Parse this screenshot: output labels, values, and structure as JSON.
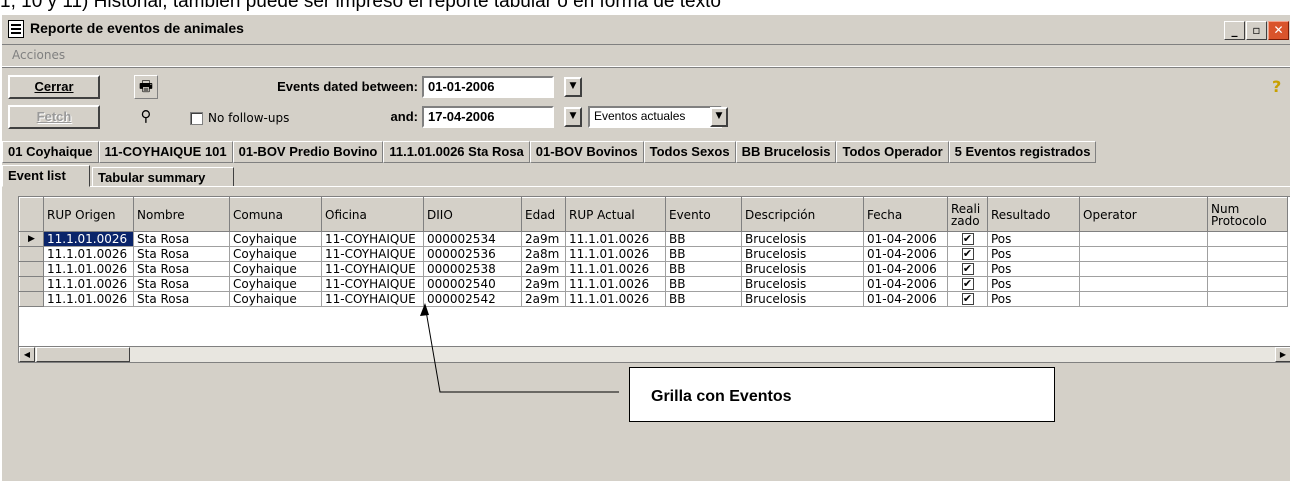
{
  "caption_text": "1, 10 y 11) Historial, tambien puede ser impreso el reporte tabular o en forma de texto",
  "window": {
    "title": "Reporte de eventos de animales",
    "minimize": "_",
    "restore": "▫",
    "close": "✕"
  },
  "menu": {
    "acciones": "Acciones"
  },
  "toolbar": {
    "cerrar": "Cerrar",
    "fetch": "Fetch",
    "events_between_label": "Events dated between:",
    "date_from": "01-01-2006",
    "and_label": "and:",
    "date_to": "17-04-2006",
    "no_followups_label": "No follow-ups",
    "eventos_select": "Eventos actuales"
  },
  "filters": [
    "01 Coyhaique",
    "11-COYHAIQUE 101",
    "01-BOV Predio Bovino",
    "11.1.01.0026 Sta Rosa",
    "01-BOV Bovinos",
    "Todos Sexos",
    "BB Brucelosis",
    "Todos Operador",
    "5 Eventos registrados"
  ],
  "tabs": [
    "Event list",
    "Tabular summary"
  ],
  "grid": {
    "headers": [
      "RUP Origen",
      "Nombre",
      "Comuna",
      "Oficina",
      "DIIO",
      "Edad",
      "RUP Actual",
      "Evento",
      "Descripción",
      "Fecha",
      "Reali zado",
      "Resultado",
      "Operator",
      "Num Protocolo"
    ],
    "rows": [
      [
        "11.1.01.0026",
        "Sta Rosa",
        "Coyhaique",
        "11-COYHAIQUE",
        "000002534",
        "2a9m",
        "11.1.01.0026",
        "BB",
        "Brucelosis",
        "01-04-2006",
        "✔",
        "Pos",
        "",
        ""
      ],
      [
        "11.1.01.0026",
        "Sta Rosa",
        "Coyhaique",
        "11-COYHAIQUE",
        "000002536",
        "2a8m",
        "11.1.01.0026",
        "BB",
        "Brucelosis",
        "01-04-2006",
        "✔",
        "Pos",
        "",
        ""
      ],
      [
        "11.1.01.0026",
        "Sta Rosa",
        "Coyhaique",
        "11-COYHAIQUE",
        "000002538",
        "2a9m",
        "11.1.01.0026",
        "BB",
        "Brucelosis",
        "01-04-2006",
        "✔",
        "Pos",
        "",
        ""
      ],
      [
        "11.1.01.0026",
        "Sta Rosa",
        "Coyhaique",
        "11-COYHAIQUE",
        "000002540",
        "2a9m",
        "11.1.01.0026",
        "BB",
        "Brucelosis",
        "01-04-2006",
        "✔",
        "Pos",
        "",
        ""
      ],
      [
        "11.1.01.0026",
        "Sta Rosa",
        "Coyhaique",
        "11-COYHAIQUE",
        "000002542",
        "2a9m",
        "11.1.01.0026",
        "BB",
        "Brucelosis",
        "01-04-2006",
        "✔",
        "Pos",
        "",
        ""
      ]
    ]
  },
  "callout": {
    "text": "Grilla con Eventos"
  },
  "colors": {
    "face": "#d4d0c8",
    "selection": "#0a246a",
    "close_button": "#d9542b"
  },
  "icons": {
    "printer": "printer-icon",
    "binoculars": "binoculars-icon",
    "help": "help-icon"
  }
}
